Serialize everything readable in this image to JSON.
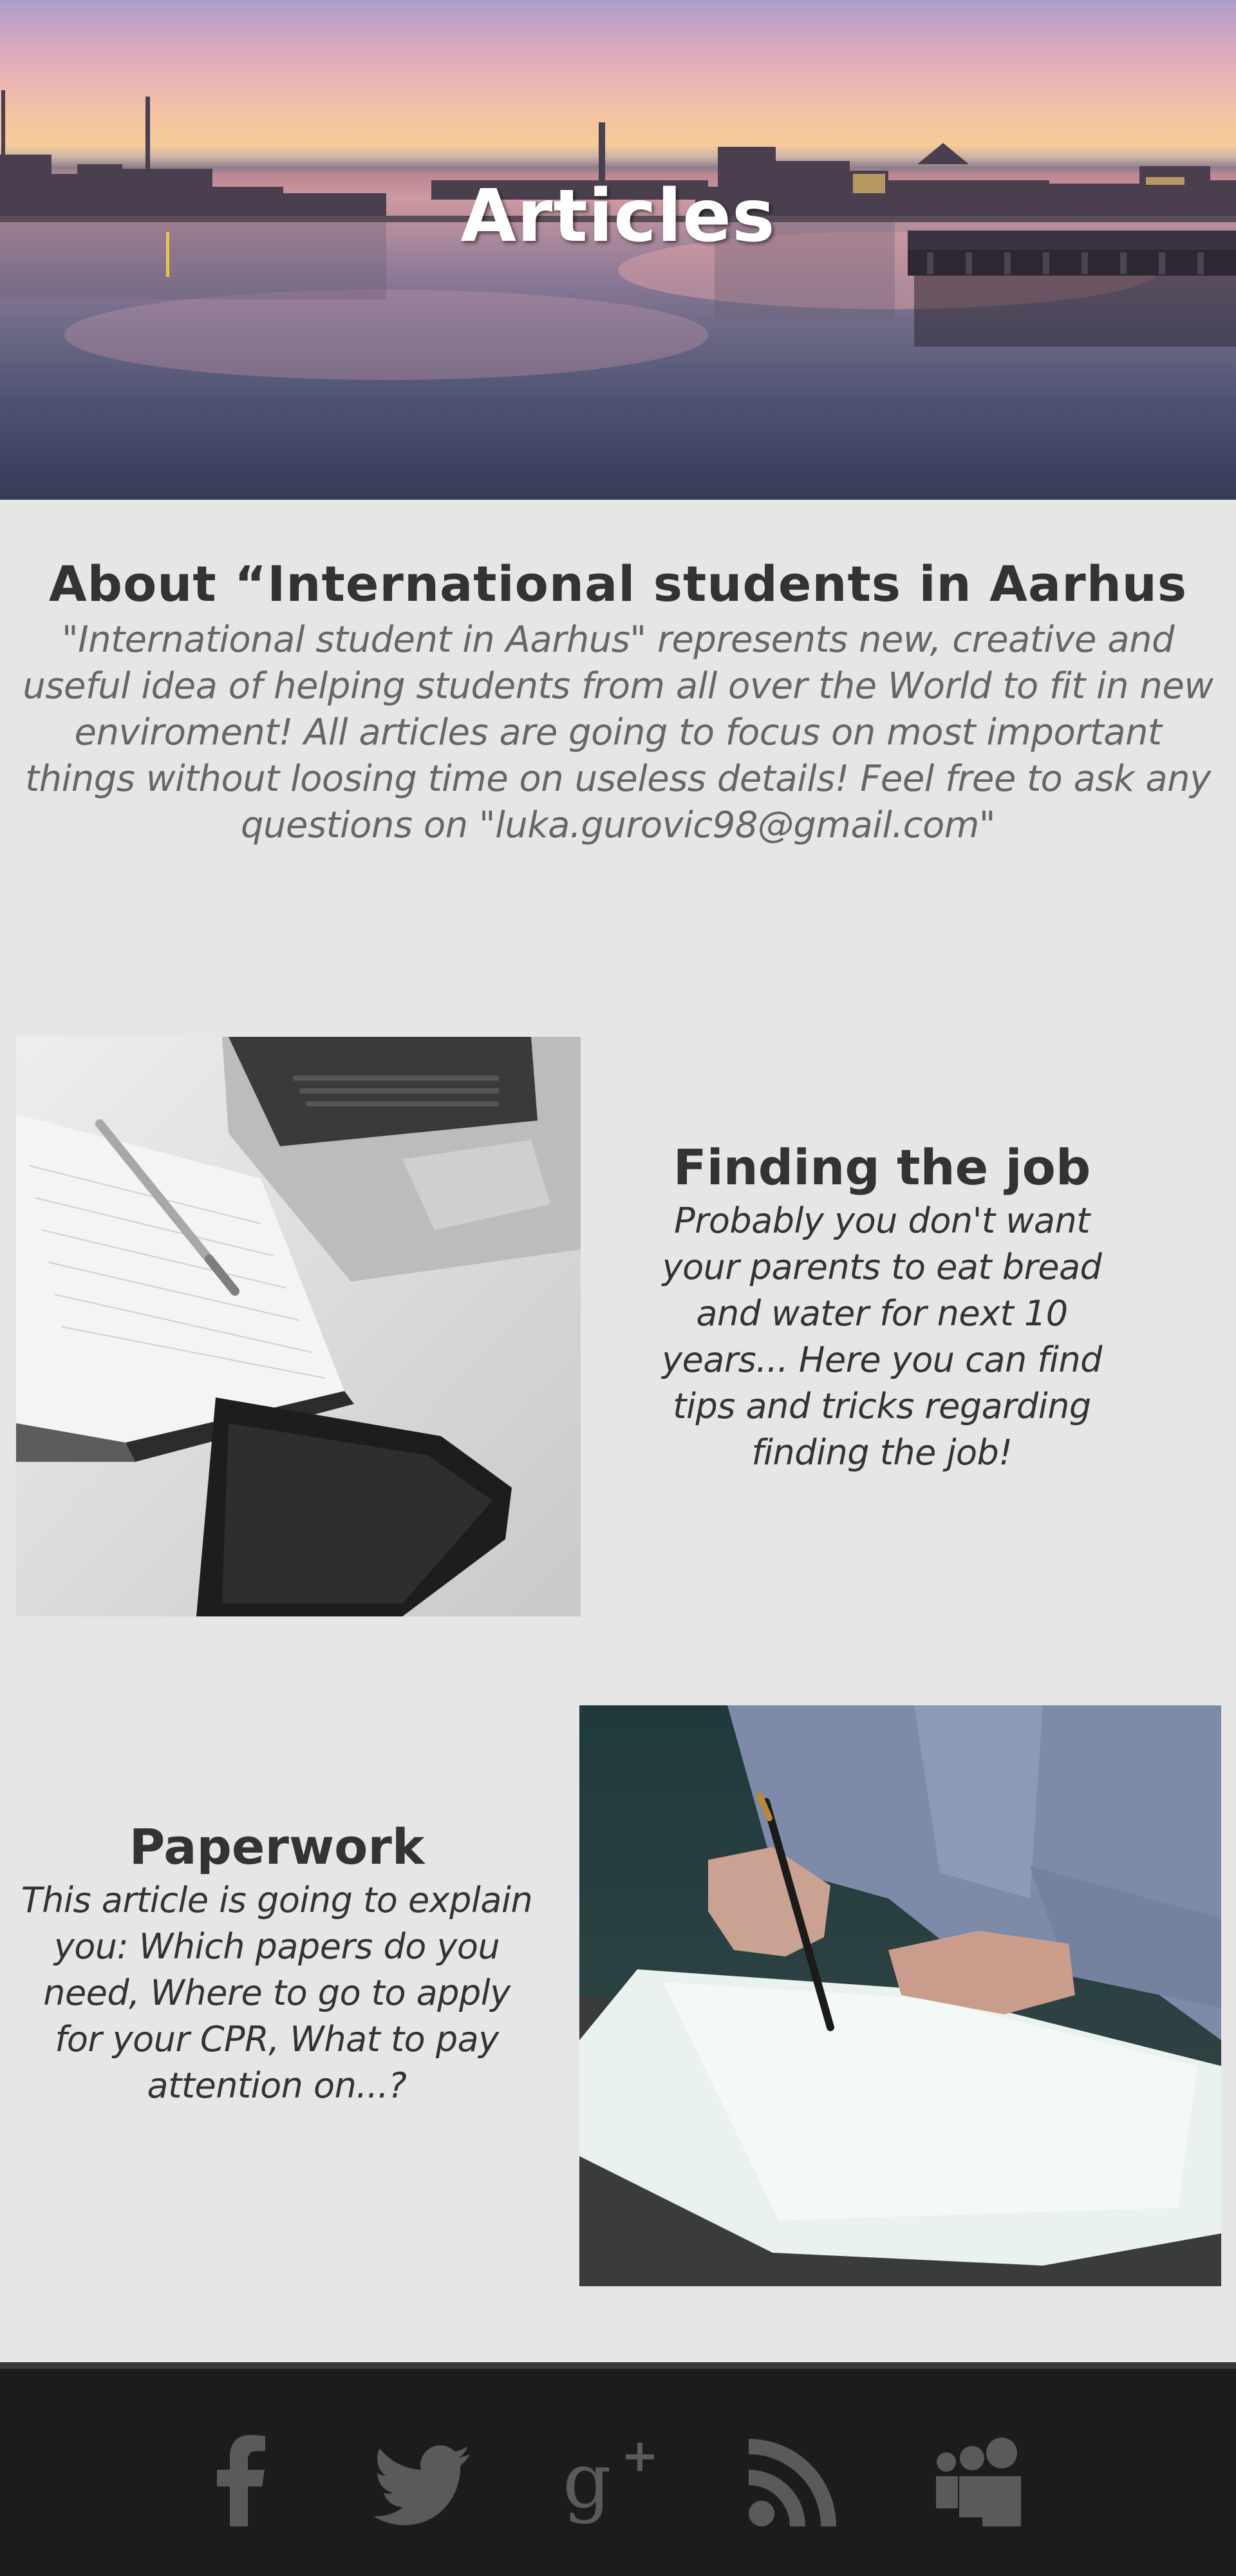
{
  "hero": {
    "title": "Articles"
  },
  "about": {
    "title": "About “International students in Aarhus",
    "lines": [
      "\"International student in Aarhus\" represents new, creative and",
      "useful idea of helping students from all over the World to fit in new",
      "enviroment! All articles are going to focus on most important",
      "things without loosing time on useless details! Feel free to ask any",
      "questions on \"luka.gurovic98@gmail.com\""
    ]
  },
  "articles": [
    {
      "title": "Finding the job",
      "lines": [
        "Probably you don't want",
        "your parents to eat bread",
        "and water for next 10",
        "years... Here you can find",
        "tips and tricks regarding",
        "finding the job!"
      ]
    },
    {
      "title": "Paperwork",
      "lines": [
        "This article is going to explain",
        "you: Which papers do you",
        "need, Where to go to apply",
        "for your CPR, What to pay",
        "attention on...?"
      ]
    }
  ],
  "footer": {
    "icons": [
      "facebook-icon",
      "twitter-icon",
      "google-plus-icon",
      "rss-icon",
      "myspace-icon"
    ],
    "icon_color": "#5a5a5a"
  }
}
